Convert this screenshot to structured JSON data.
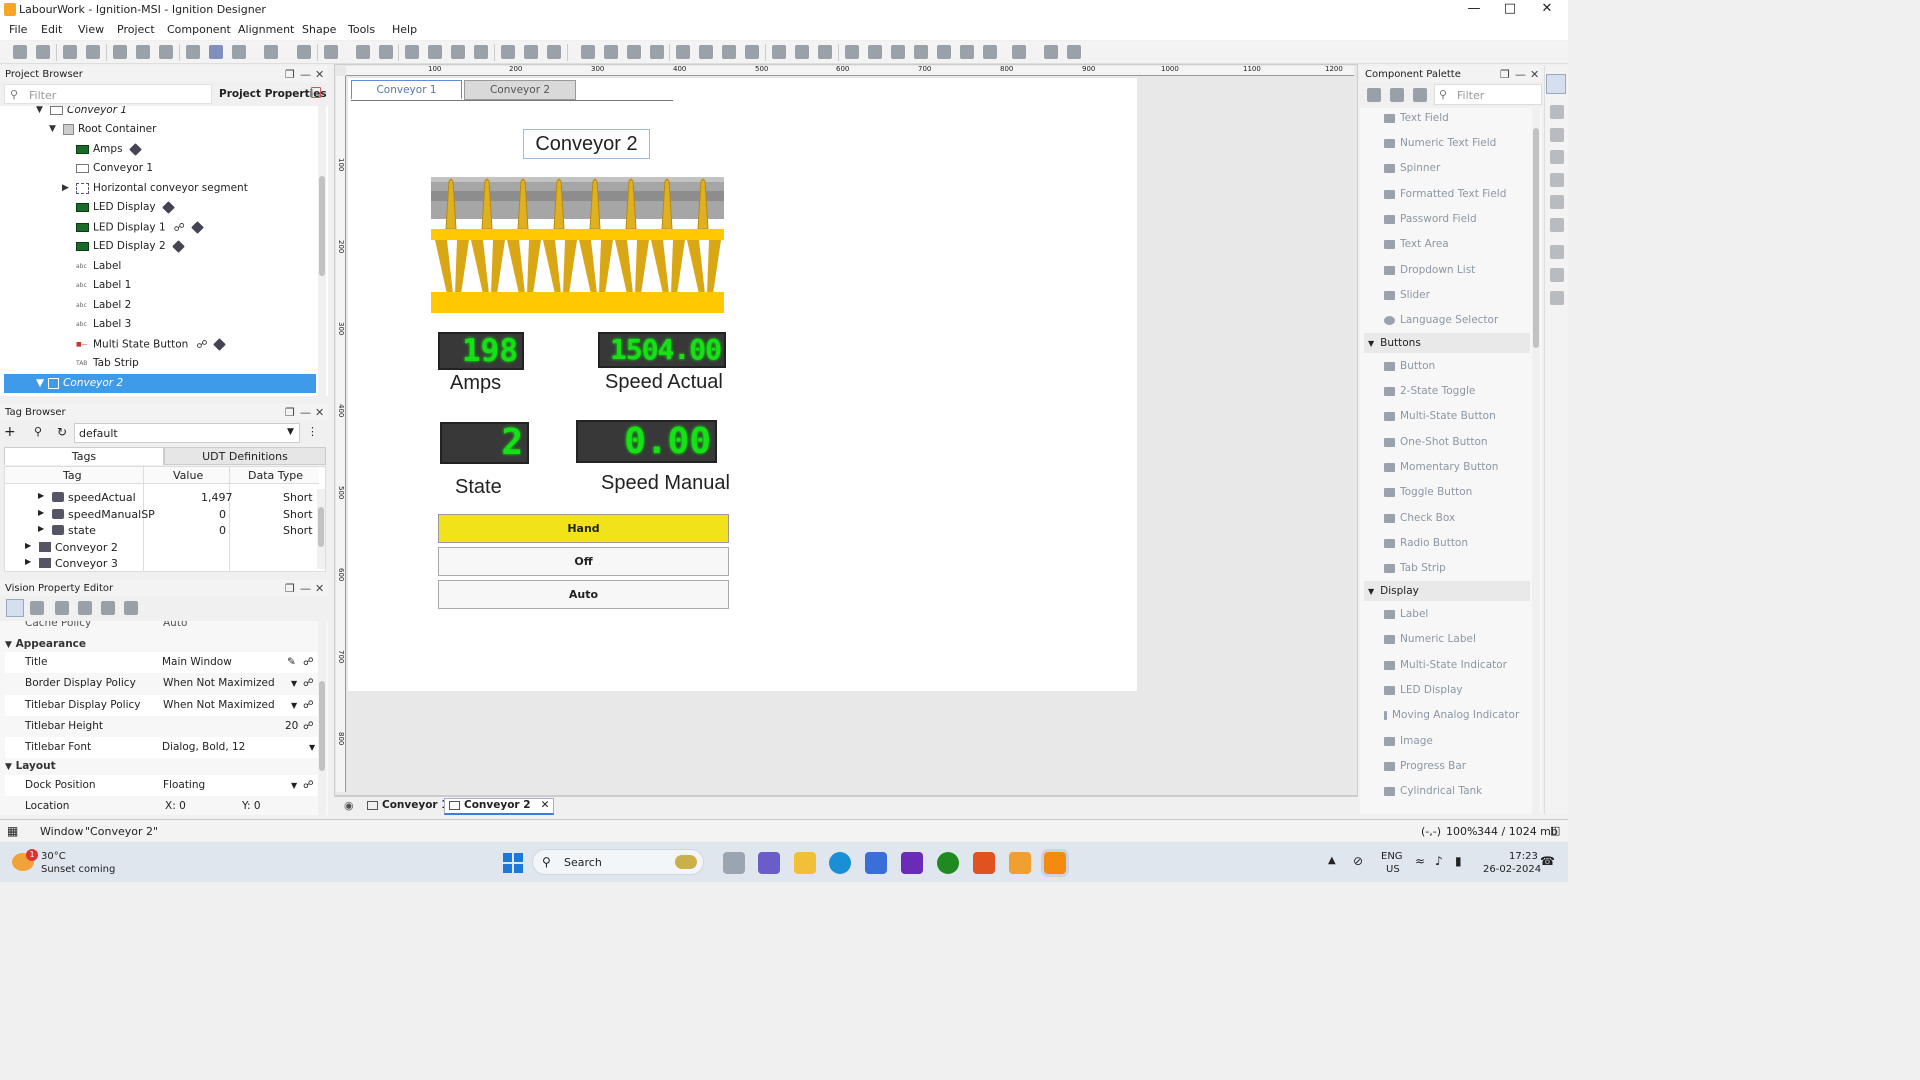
{
  "window": {
    "title": "LabourWork - Ignition-MSI - Ignition Designer"
  },
  "menu": [
    "File",
    "Edit",
    "View",
    "Project",
    "Component",
    "Alignment",
    "Shape",
    "Tools",
    "Help"
  ],
  "project_browser": {
    "title": "Project Browser",
    "filter_placeholder": "Filter",
    "project_properties": "Project Properties",
    "items": [
      "Conveyor 1",
      "Root Container",
      "Amps",
      "Conveyor 1",
      "Horizontal conveyor segment",
      "LED Display",
      "LED Display 1",
      "LED Display 2",
      "Label",
      "Label 1",
      "Label 2",
      "Label 3",
      "Multi State Button",
      "Tab Strip",
      "Conveyor 2"
    ]
  },
  "tag_browser": {
    "title": "Tag Browser",
    "provider": "default",
    "tabs": [
      "Tags",
      "UDT Definitions"
    ],
    "columns": [
      "Tag",
      "Value",
      "Data Type"
    ],
    "rows": [
      {
        "name": "speedActual",
        "value": "1,497",
        "type": "Short"
      },
      {
        "name": "speedManualSP",
        "value": "0",
        "type": "Short"
      },
      {
        "name": "state",
        "value": "0",
        "type": "Short"
      },
      {
        "name": "Conveyor 2",
        "value": "",
        "type": ""
      },
      {
        "name": "Conveyor 3",
        "value": "",
        "type": ""
      }
    ]
  },
  "property_editor": {
    "title": "Vision Property Editor",
    "partial_top": "Cache Policy",
    "partial_top_value": "Auto",
    "sections": {
      "appearance": "Appearance",
      "layout": "Layout"
    },
    "appearance": [
      {
        "name": "Title",
        "value": "Main Window"
      },
      {
        "name": "Border Display Policy",
        "value": "When Not Maximized"
      },
      {
        "name": "Titlebar Display Policy",
        "value": "When Not Maximized"
      },
      {
        "name": "Titlebar Height",
        "value": "20"
      },
      {
        "name": "Titlebar Font",
        "value": "Dialog, Bold, 12"
      }
    ],
    "layout": [
      {
        "name": "Dock Position",
        "value": "Floating"
      },
      {
        "name": "Location",
        "x": "X: 0",
        "y": "Y: 0"
      }
    ]
  },
  "canvas": {
    "ruler_marks": [
      "100",
      "200",
      "300",
      "400",
      "500",
      "600",
      "700",
      "800",
      "900",
      "1000",
      "1100",
      "1200"
    ],
    "vruler_marks": [
      "100",
      "200",
      "300",
      "400",
      "500",
      "600",
      "700",
      "800"
    ],
    "tabs": [
      "Conveyor 1",
      "Conveyor 2"
    ],
    "header_label": "Conveyor 2",
    "amps_value": "198",
    "amps_label": "Amps",
    "speed_actual_value": "1504.00",
    "speed_actual_label": "Speed Actual",
    "state_value": "2",
    "state_label": "State",
    "speed_manual_value": "0.00",
    "speed_manual_label": "Speed Manual",
    "buttons": [
      "Hand",
      "Off",
      "Auto"
    ]
  },
  "bottom_tabs": [
    "Conveyor 1",
    "Conveyor 2"
  ],
  "palette": {
    "title": "Component Palette",
    "filter_placeholder": "Filter",
    "input_items": [
      "Text Field",
      "Numeric Text Field",
      "Spinner",
      "Formatted Text Field",
      "Password Field",
      "Text Area",
      "Dropdown List",
      "Slider",
      "Language Selector"
    ],
    "buttons_section": "Buttons",
    "button_items": [
      "Button",
      "2-State Toggle",
      "Multi-State Button",
      "One-Shot Button",
      "Momentary Button",
      "Toggle Button",
      "Check Box",
      "Radio Button",
      "Tab Strip"
    ],
    "display_section": "Display",
    "display_items": [
      "Label",
      "Numeric Label",
      "Multi-State Indicator",
      "LED Display",
      "Moving Analog Indicator",
      "Image",
      "Progress Bar",
      "Cylindrical Tank"
    ]
  },
  "status": {
    "window_text": "Window",
    "window_name": "\"Conveyor 2\"",
    "coords": "(-,-)",
    "zoom": "100%",
    "memory": "344 / 1024 mb"
  },
  "taskbar": {
    "weather_temp": "30°C",
    "weather_text": "Sunset coming",
    "badge": "1",
    "search": "Search",
    "lang1": "ENG",
    "lang2": "US",
    "time": "17:23",
    "date": "26-02-2024"
  },
  "colors": {
    "selection": "#3d9be9",
    "led_bg": "#383838",
    "led_fg": "#16e016",
    "hand_button": "#f2e21a",
    "conveyor_yellow": "#ffc800"
  }
}
